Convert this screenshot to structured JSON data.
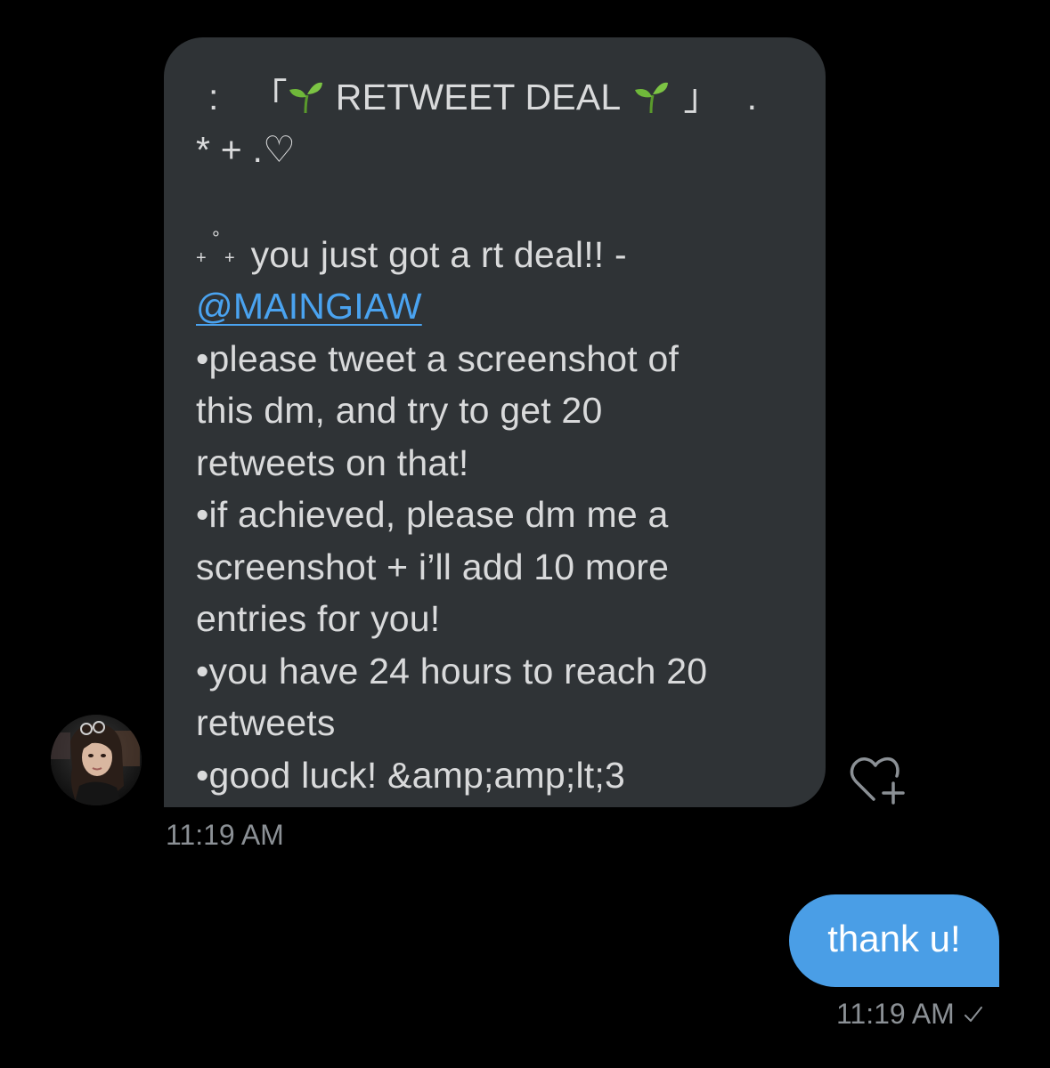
{
  "incoming": {
    "title_prefix": ":",
    "corner_open": "「",
    "title": "RETWEET DEAL",
    "corner_close": "」",
    "title_suffix": ".",
    "decor": "* + .♡",
    "intro": "you just got a rt deal!! -",
    "mention": "@MAINGIAW",
    "lines": [
      "•please tweet a screenshot of",
      "this dm, and try to get 20",
      "retweets on that!",
      "•if achieved, please dm me a",
      "screenshot + i’ll add 10 more",
      "entries for you!",
      "•you have 24 hours to reach 20",
      "retweets",
      "•good luck! &amp;amp;lt;3"
    ],
    "timestamp": "11:19 AM"
  },
  "outgoing": {
    "text": "thank u!",
    "timestamp": "11:19 AM"
  },
  "icons": {
    "sprout": "sprout-emoji",
    "react": "heart-plus-icon",
    "read": "checkmark-icon"
  },
  "colors": {
    "background": "#000000",
    "incoming_bubble": "#2f3336",
    "outgoing_bubble": "#4a9ee6",
    "link": "#4aa3f0",
    "timestamp": "#8b9095"
  }
}
